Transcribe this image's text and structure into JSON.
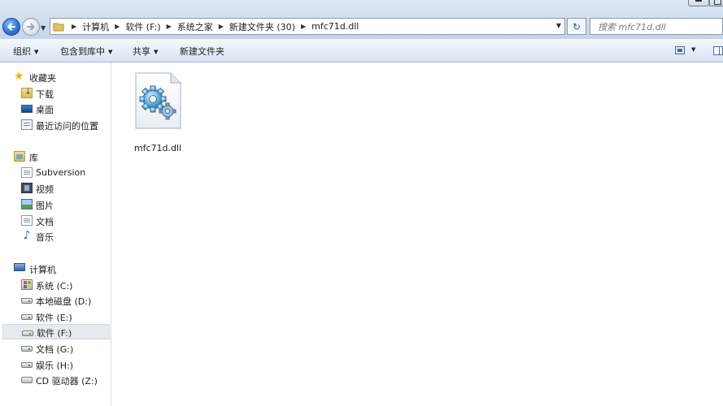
{
  "address_bar": {
    "crumbs": [
      "计算机",
      "软件 (F:)",
      "系统之家",
      "新建文件夹 (30)",
      "mfc71d.dll"
    ],
    "search_placeholder": "搜索 mfc71d.dll"
  },
  "toolbar": {
    "organize": "组织",
    "include_in_library": "包含到库中",
    "share": "共享",
    "new_folder": "新建文件夹"
  },
  "nav": {
    "favorites": {
      "label": "收藏夹",
      "items": [
        "下载",
        "桌面",
        "最近访问的位置"
      ]
    },
    "libraries": {
      "label": "库",
      "items": [
        "Subversion",
        "视频",
        "图片",
        "文档",
        "音乐"
      ]
    },
    "computer": {
      "label": "计算机",
      "items": [
        "系统 (C:)",
        "本地磁盘 (D:)",
        "软件 (E:)",
        "软件 (F:)",
        "文档 (G:)",
        "娱乐 (H:)",
        "CD 驱动器 (Z:)"
      ],
      "selected": "软件 (F:)"
    }
  },
  "files": [
    {
      "name": "mfc71d.dll",
      "icon": "dll-settings-icon"
    }
  ],
  "colors": {
    "selection": "#e7eaee",
    "chrome": "#dae5f2"
  }
}
